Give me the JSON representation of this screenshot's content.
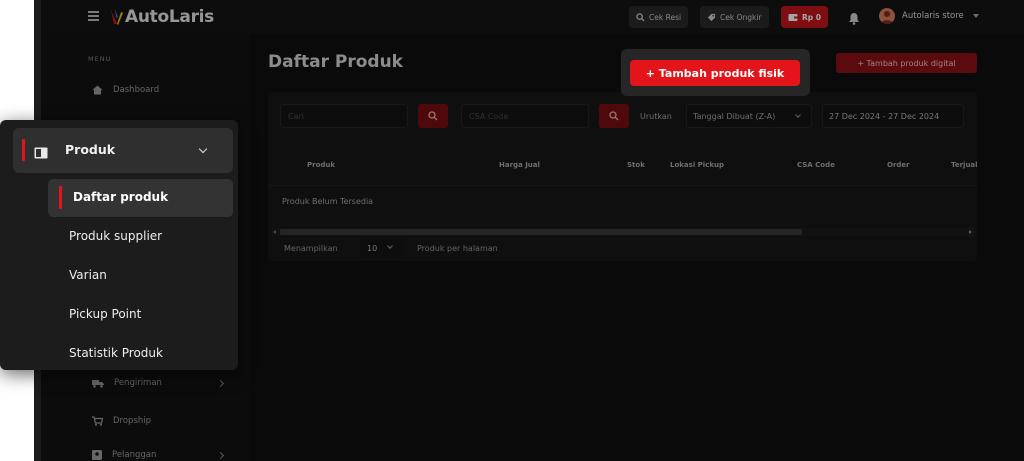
{
  "header": {
    "app_name": "AutoLaris",
    "cek_resi": "Cek Resi",
    "cek_ongkir": "Cek Ongkir",
    "balance": "Rp 0",
    "store_name": "Autolaris store"
  },
  "sidebar": {
    "menu_label": "MENU",
    "items": [
      {
        "label": "Dashboard",
        "icon": "home-icon"
      },
      {
        "label": "Pengiriman",
        "icon": "truck-icon"
      },
      {
        "label": "Dropship",
        "icon": "cart-icon"
      },
      {
        "label": "Pelanggan",
        "icon": "user-icon"
      }
    ]
  },
  "submenu": {
    "title": "Produk",
    "items": [
      {
        "label": "Daftar produk",
        "active": true
      },
      {
        "label": "Produk supplier",
        "active": false
      },
      {
        "label": "Varian",
        "active": false
      },
      {
        "label": "Pickup Point",
        "active": false
      },
      {
        "label": "Statistik Produk",
        "active": false
      }
    ]
  },
  "main": {
    "title": "Daftar Produk",
    "add_physical": "+ Tambah produk fisik",
    "add_digital": "+ Tambah produk digital",
    "search_placeholder": "Cari",
    "csa_placeholder": "CSA Code",
    "sort_label": "Urutkan",
    "sort_value": "Tanggal Dibuat (Z-A)",
    "date_range": "27 Dec 2024 - 27 Dec 2024",
    "table": {
      "columns": [
        "Produk",
        "Harga Jual",
        "Stok",
        "Lokasi Pickup",
        "CSA Code",
        "Order",
        "Terjual"
      ],
      "empty_text": "Produk Belum Tersedia"
    },
    "footer": {
      "showing": "Menampilkan",
      "per_page_value": "10",
      "per_page_label": "Produk per halaman"
    }
  },
  "colors": {
    "accent": "#e3151a",
    "background": "#101010"
  }
}
